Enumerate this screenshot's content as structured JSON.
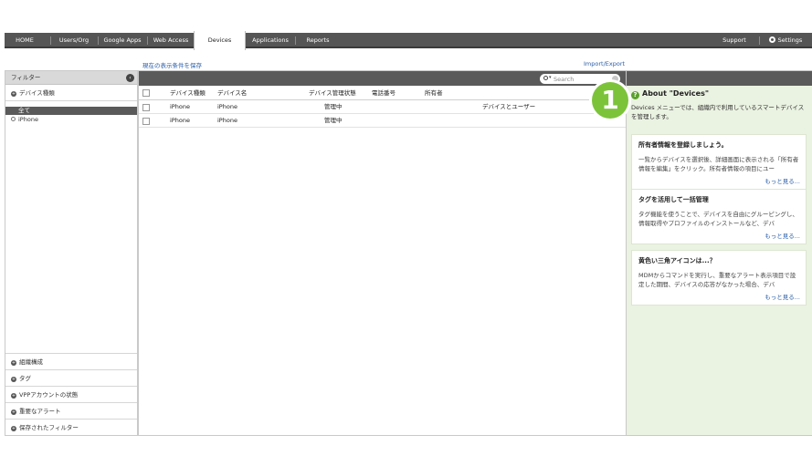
{
  "nav": {
    "home": "HOME",
    "users_org": "Users/Org",
    "google_apps": "Google Apps",
    "web_access": "Web Access",
    "devices": "Devices",
    "applications": "Applications",
    "reports": "Reports",
    "support": "Support",
    "settings": "Settings"
  },
  "links": {
    "save_filter": "現在の表示条件を保存",
    "import_export": "Import/Export"
  },
  "filter": {
    "title": "フィルター",
    "device_type": "デバイス種類",
    "all": "全て",
    "iphone": "iPhone",
    "bottom": [
      "組織構成",
      "タグ",
      "VPPアカウントの状態",
      "重要なアラート",
      "保存されたフィルター"
    ]
  },
  "search": {
    "placeholder": "Search"
  },
  "table": {
    "headers": [
      "デバイス種類",
      "デバイス名",
      "デバイス管理状態",
      "電話番号",
      "所有者"
    ],
    "rows": [
      [
        "iPhone",
        "iPhone",
        "管理中",
        "",
        "",
        "デバイスとユーザー"
      ],
      [
        "iPhone",
        "iPhone",
        "管理中",
        "",
        "",
        ""
      ]
    ]
  },
  "callout": {
    "number": "1"
  },
  "about": {
    "title": "About \"Devices\"",
    "desc": "Devices メニューでは、組織内で利用しているスマートデバイスを管理します。",
    "cards": [
      {
        "title": "所有者情報を登録しましょう。",
        "body": "一覧からデバイスを選択後、詳細画面に表示される「所有者情報を編集」をクリック。所有者情報の項目にユー",
        "more": "もっと見る..."
      },
      {
        "title": "タグを活用して一括管理",
        "body": "タグ機能を使うことで、デバイスを自由にグルーピングし、情報取得やプロファイルのインストールなど、デバ",
        "more": "もっと見る..."
      },
      {
        "title": "黄色い三角アイコンは...？",
        "body": "MDMからコマンドを実行し、重要なアラート表示項目で設定した期間、デバイスの応答がなかった場合、デバ",
        "more": "もっと見る..."
      }
    ]
  },
  "colors": {
    "nav_bg": "#555555",
    "toolbar_bg": "#5a5a5a",
    "right_panel_bg": "#eaf2e1",
    "link": "#2a5ea8",
    "badge": "#7cc33a"
  }
}
